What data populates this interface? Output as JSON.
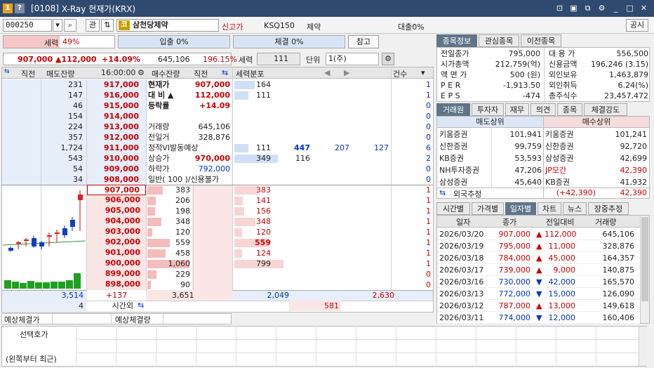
{
  "title": {
    "number": "[0108]",
    "name": "X-Ray 현재가(KRX)"
  },
  "toolbar": {
    "code": "000250",
    "gwan": "관",
    "stock_badge": "코",
    "stock_name": "삼천당제약",
    "flag_label": "신고가",
    "index": "KSQ150",
    "sector": "제약",
    "loan": "대출0%",
    "gongsi": "공시"
  },
  "force": {
    "label": "세력",
    "pct": "49%",
    "in_label": "입출 0%",
    "trade_label": "체결 0%",
    "ref": "참고"
  },
  "price_bar": {
    "price": "907,000",
    "change": "▲112,000",
    "pct": "+14.09%",
    "volume": "645,106",
    "ratio": "196.15%"
  },
  "ctrl": {
    "force_label": "세력",
    "force_val": "111",
    "unit_label": "단위",
    "unit_val": "1(주)"
  },
  "ob_header": {
    "prev": "직전",
    "ask_bal": "매도잔량",
    "time": "16:00:00",
    "bid_bal": "매수잔량",
    "prev2": "직전",
    "dist": "세력분포",
    "count": "건수"
  },
  "asks": [
    {
      "qty": "231",
      "price": "917,000"
    },
    {
      "qty": "147",
      "price": "916,000"
    },
    {
      "qty": "46",
      "price": "915,000"
    },
    {
      "qty": "154",
      "price": "914,000"
    },
    {
      "qty": "224",
      "price": "913,000"
    },
    {
      "qty": "357",
      "price": "912,000"
    },
    {
      "qty": "1,724",
      "price": "911,000"
    },
    {
      "qty": "543",
      "price": "910,000"
    },
    {
      "qty": "54",
      "price": "909,000"
    },
    {
      "qty": "34",
      "price": "908,000"
    }
  ],
  "bids": [
    {
      "price": "907,000",
      "qty": "383"
    },
    {
      "price": "906,000",
      "qty": "206"
    },
    {
      "price": "905,000",
      "qty": "198"
    },
    {
      "price": "904,000",
      "qty": "348"
    },
    {
      "price": "903,000",
      "qty": "120"
    },
    {
      "price": "902,000",
      "qty": "559"
    },
    {
      "price": "901,000",
      "qty": "458"
    },
    {
      "price": "900,000",
      "qty": "1,060"
    },
    {
      "price": "899,000",
      "qty": "229"
    },
    {
      "price": "898,000",
      "qty": "90"
    }
  ],
  "info": [
    {
      "label": "현재가",
      "value": "907,000"
    },
    {
      "label": "대 비 ▲",
      "value": "112,000"
    },
    {
      "label": "등락률",
      "value": "+14.09"
    },
    {
      "label": "",
      "value": ""
    },
    {
      "label": "거래량",
      "value": "645,106"
    },
    {
      "label": "전일거",
      "value": "328,876"
    },
    {
      "label": "정적VI발동예상",
      "value": ""
    },
    {
      "label": "상승가",
      "value": "970,000"
    },
    {
      "label": "하락가",
      "value": "792,000"
    },
    {
      "label": "일반( 100 )/신용불가",
      "value": ""
    }
  ],
  "dist_ask": [
    {
      "a": "164",
      "b": "",
      "c": "",
      "d": "",
      "cnt": "1"
    },
    {
      "a": "111",
      "b": "",
      "c": "",
      "d": "",
      "cnt": "1"
    },
    {
      "a": "",
      "b": "",
      "c": "",
      "d": "",
      "cnt": "0"
    },
    {
      "a": "",
      "b": "",
      "c": "",
      "d": "",
      "cnt": "0"
    },
    {
      "a": "",
      "b": "",
      "c": "",
      "d": "",
      "cnt": "0"
    },
    {
      "a": "",
      "b": "",
      "c": "",
      "d": "",
      "cnt": "0"
    },
    {
      "a": "111",
      "b": "447",
      "c": "207",
      "d": "127",
      "cnt": "6"
    },
    {
      "a": "349",
      "b": "116",
      "c": "",
      "d": "",
      "cnt": "2"
    },
    {
      "a": "",
      "b": "",
      "c": "",
      "d": "",
      "cnt": "0"
    },
    {
      "a": "",
      "b": "",
      "c": "",
      "d": "",
      "cnt": "0"
    }
  ],
  "dist_bid": [
    {
      "a": "383",
      "cnt": "1"
    },
    {
      "a": "141",
      "cnt": "1"
    },
    {
      "a": "156",
      "cnt": "1"
    },
    {
      "a": "348",
      "cnt": "1"
    },
    {
      "a": "120",
      "cnt": "1"
    },
    {
      "a": "559",
      "cnt": "1"
    },
    {
      "a": "124",
      "cnt": "1"
    },
    {
      "a": "799",
      "cnt": "1"
    },
    {
      "a": "",
      "cnt": "0"
    },
    {
      "a": "",
      "cnt": "0"
    }
  ],
  "totals": {
    "ask_total": "3,514",
    "diff": "+137",
    "bid_total": "3,651",
    "dist_a": "2,049",
    "dist_b": "2,630",
    "after_qty": "4",
    "after_label": "시간외",
    "after_dist": "581"
  },
  "expected": {
    "price_label": "예상체결가",
    "qty_label": "예상체결량"
  },
  "select": {
    "label1": "선택호가",
    "label2": "(왼쪽부터 최근)"
  },
  "right_tabs1": [
    "종목정보",
    "관심종목",
    "이전종목"
  ],
  "summary_left": [
    {
      "label": "전일종가",
      "value": "795,000"
    },
    {
      "label": "시가총액",
      "value": "212,759(억)"
    },
    {
      "label": "액 면 가",
      "value": "500 (원)"
    },
    {
      "label": "P E R",
      "value": "-1,913.50"
    },
    {
      "label": "E P S",
      "value": "-474"
    }
  ],
  "summary_right": [
    {
      "label": "대 용 가",
      "value": "556,500"
    },
    {
      "label": "신용금액",
      "value": "196,246  (3.15)"
    },
    {
      "label": "외인보유",
      "value": "1,463,879"
    },
    {
      "label": "외인취득",
      "value": "6.24(%)"
    },
    {
      "label": "총주식수",
      "value": "23,457,472"
    }
  ],
  "right_tabs2": [
    "거래원",
    "투자자",
    "재무",
    "의견",
    "종목",
    "체결강도"
  ],
  "broker_head": {
    "sell": "매도상위",
    "buy": "매수상위"
  },
  "brokers": [
    {
      "sname": "키움증권",
      "sqty": "101,941",
      "bname": "키움증권",
      "bqty": "101,241"
    },
    {
      "sname": "신한증권",
      "sqty": "99,759",
      "bname": "신한증권",
      "bqty": "92,720"
    },
    {
      "sname": "KB증권",
      "sqty": "53,593",
      "bname": "삼성증권",
      "bqty": "42,699"
    },
    {
      "sname": "NH투자증권",
      "sqty": "47,206",
      "bname": "JP모간",
      "bqty": "42,390"
    },
    {
      "sname": "삼성증권",
      "sqty": "45,640",
      "bname": "KB증권",
      "bqty": "41,932"
    }
  ],
  "foreign": {
    "label": "외국추정",
    "diff": "(+42,390)",
    "qty": "42,390"
  },
  "right_tabs3": [
    "시간별",
    "가격별",
    "일자별",
    "차트",
    "뉴스",
    "장중추정"
  ],
  "daily_head": {
    "date": "일자",
    "close": "종가",
    "change": "전일대비",
    "vol": "거래량"
  },
  "daily": [
    {
      "date": "2026/03/20",
      "close": "907,000",
      "dir": "▲",
      "change": "112,000",
      "vol": "645,106",
      "up": true
    },
    {
      "date": "2026/03/19",
      "close": "795,000",
      "dir": "▲",
      "change": "11,000",
      "vol": "328,876",
      "up": true
    },
    {
      "date": "2026/03/18",
      "close": "784,000",
      "dir": "▲",
      "change": "45,000",
      "vol": "164,357",
      "up": true
    },
    {
      "date": "2026/03/17",
      "close": "739,000",
      "dir": "▲",
      "change": "9,000",
      "vol": "140,875",
      "up": true
    },
    {
      "date": "2026/03/16",
      "close": "730,000",
      "dir": "▼",
      "change": "42,000",
      "vol": "165,570",
      "up": false
    },
    {
      "date": "2026/03/13",
      "close": "772,000",
      "dir": "▼",
      "change": "15,000",
      "vol": "126,090",
      "up": false
    },
    {
      "date": "2026/03/12",
      "close": "787,000",
      "dir": "▲",
      "change": "13,000",
      "vol": "149,618",
      "up": true
    },
    {
      "date": "2026/03/11",
      "close": "774,000",
      "dir": "▼",
      "change": "12,000",
      "vol": "160,406",
      "up": false
    }
  ],
  "colors": {
    "up": "#cc0000",
    "down": "#0033cc",
    "ask_bg": "#e6eefa",
    "bid_bg": "#fbe6e6",
    "title": "#2f4a6e"
  }
}
